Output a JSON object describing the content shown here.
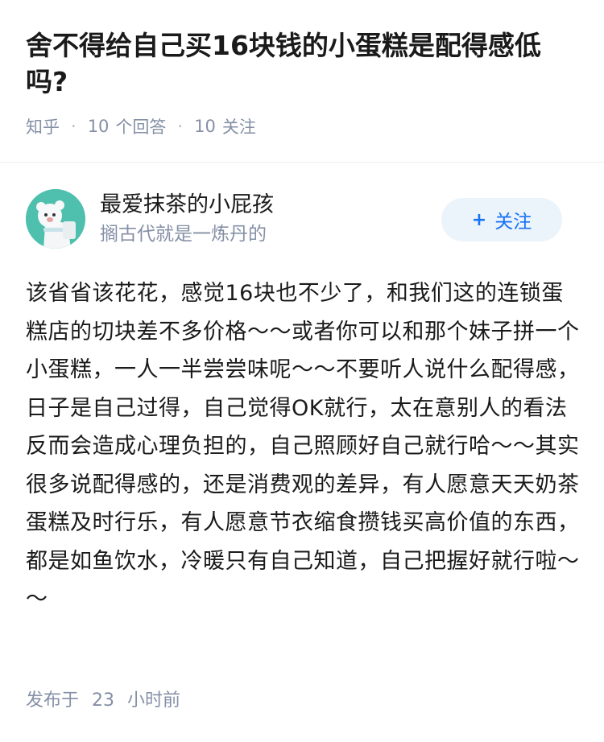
{
  "question": {
    "title": "舍不得给自己买16块钱的小蛋糕是配得感低吗?",
    "source": "知乎",
    "answer_count": "10",
    "answer_label": "个回答",
    "follower_count": "10",
    "follower_label": "关注"
  },
  "answer": {
    "author_name": "最爱抹茶的小屁孩",
    "author_bio": "搁古代就是一炼丹的",
    "follow_label": "关注",
    "follow_icon": "plus-icon",
    "content": "该省省该花花，感觉16块也不少了，和我们这的连锁蛋糕店的切块差不多价格～～或者你可以和那个妹子拼一个小蛋糕，一人一半尝尝味呢～～不要听人说什么配得感，日子是自己过得，自己觉得OK就行，太在意别人的看法反而会造成心理负担的，自己照顾好自己就行哈～～其实很多说配得感的，还是消费观的差异，有人愿意天天奶茶蛋糕及时行乐，有人愿意节衣缩食攒钱买高价值的东西，都是如鱼饮水，冷暖只有自己知道，自己把握好就行啦～～",
    "published_prefix": "发布于",
    "published_value": "23",
    "published_unit": "小时前"
  },
  "colors": {
    "accent": "#1772f6",
    "follow_bg": "#ebf3fb",
    "meta_gray": "#8590a6",
    "avatar_bg": "#4fbfae"
  }
}
